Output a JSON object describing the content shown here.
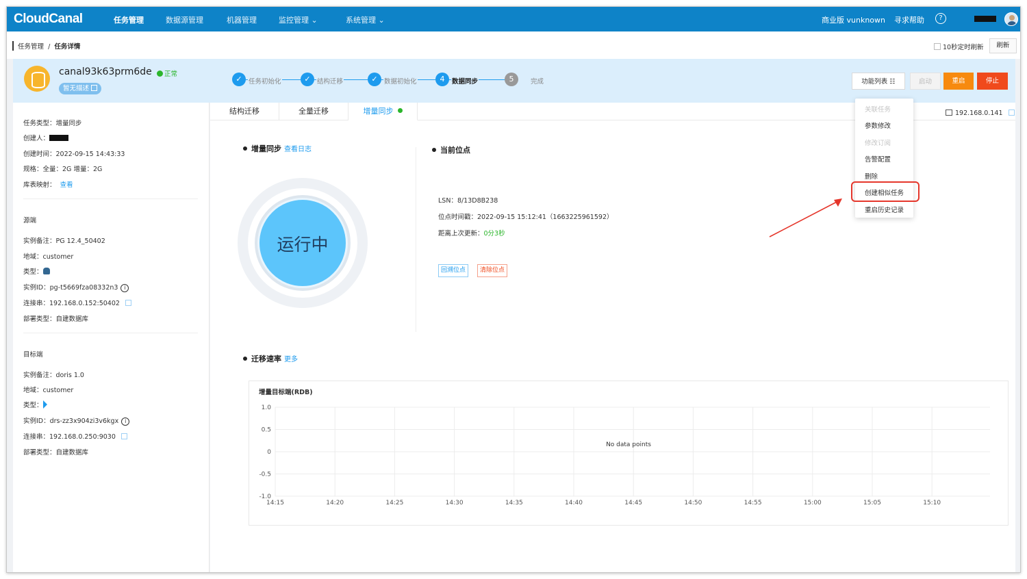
{
  "topnav": {
    "logo": "CloudCanal",
    "items": [
      "任务管理",
      "数据源管理",
      "机器管理",
      "监控管理 ⌄",
      "系统管理 ⌄"
    ],
    "edition": "商业版 vunknown",
    "help": "寻求帮助",
    "help_icon": "?"
  },
  "breadcrumb": {
    "root": "任务管理",
    "sep": "/",
    "current": "任务详情"
  },
  "toolbar": {
    "auto_refresh": "10秒定时刷新",
    "refresh": "刷新"
  },
  "task": {
    "name": "canal93k63prm6de",
    "status": "正常",
    "desc": "暂无描述",
    "steps": [
      {
        "label": "任务初始化",
        "state": "done",
        "num": "✓"
      },
      {
        "label": "结构迁移",
        "state": "done",
        "num": "✓"
      },
      {
        "label": "数据初始化",
        "state": "done",
        "num": "✓"
      },
      {
        "label": "数据同步",
        "state": "current",
        "num": "4"
      },
      {
        "label": "完成",
        "state": "todo",
        "num": "5"
      }
    ],
    "buttons": {
      "func_list": "功能列表 ☷",
      "start": "启动",
      "restart": "重启",
      "stop": "停止"
    }
  },
  "left": {
    "task_type": {
      "label": "任务类型：",
      "value": "增量同步"
    },
    "creator": {
      "label": "创建人："
    },
    "created": {
      "label": "创建时间：",
      "value": "2022-09-15 14:43:33"
    },
    "spec": {
      "label": "规格：",
      "value": "全量：2G 增量：2G"
    },
    "mapping": {
      "label": "库表映射：",
      "value": "查看"
    },
    "source": {
      "title": "源端",
      "remark": {
        "label": "实例备注：",
        "value": "PG 12.4_50402"
      },
      "region": {
        "label": "地域：",
        "value": "customer"
      },
      "type": {
        "label": "类型："
      },
      "id": {
        "label": "实例ID：",
        "value": "pg-t5669fza08332n3"
      },
      "conn": {
        "label": "连接串：",
        "value": "192.168.0.152:50402"
      },
      "deploy": {
        "label": "部署类型：",
        "value": "自建数据库"
      }
    },
    "target": {
      "title": "目标端",
      "remark": {
        "label": "实例备注：",
        "value": "doris 1.0"
      },
      "region": {
        "label": "地域：",
        "value": "customer"
      },
      "type": {
        "label": "类型："
      },
      "id": {
        "label": "实例ID：",
        "value": "drs-zz3x904zi3v6kgx"
      },
      "conn": {
        "label": "连接串：",
        "value": "192.168.0.250:9030"
      },
      "deploy": {
        "label": "部署类型：",
        "value": "自建数据库"
      }
    }
  },
  "tabs": [
    "结构迁移",
    "全量迁移",
    "增量同步"
  ],
  "host": "192.168.0.141",
  "sync": {
    "title": "增量同步",
    "log_link": "查看日志",
    "running": "运行中",
    "pos_title": "当前位点",
    "lsn": {
      "label": "LSN：",
      "value": "8/13D8B238"
    },
    "pos_time": {
      "label": "位点时间戳：",
      "value": "2022-09-15 15:12:41（1663225961592）"
    },
    "last_update": {
      "label": "距离上次更新：",
      "value": "0分3秒"
    },
    "btn_rewind": "回溯位点",
    "btn_clear": "清除位点"
  },
  "rate": {
    "title": "迁移速率",
    "more": "更多"
  },
  "chart_data": {
    "type": "line",
    "title": "增量目标端(RDB)",
    "x": [
      "14:15",
      "14:20",
      "14:25",
      "14:30",
      "14:35",
      "14:40",
      "14:45",
      "14:50",
      "14:55",
      "15:00",
      "15:05",
      "15:10"
    ],
    "y_ticks": [
      "1.0",
      "0.5",
      "0",
      "-0.5",
      "-1.0"
    ],
    "ylim": [
      -1.0,
      1.0
    ],
    "series": [],
    "empty_text": "No data points",
    "grid": true
  },
  "menu": {
    "items": [
      {
        "label": "关联任务",
        "disabled": true
      },
      {
        "label": "参数修改",
        "disabled": false
      },
      {
        "label": "修改订阅",
        "disabled": true
      },
      {
        "label": "告警配置",
        "disabled": false
      },
      {
        "label": "删除",
        "disabled": false
      },
      {
        "label": "创建相似任务",
        "disabled": false
      },
      {
        "label": "重启历史记录",
        "disabled": false
      }
    ]
  },
  "colors": {
    "primary": "#1e9bee",
    "nav": "#0e83c8",
    "restart": "#f78a0f",
    "stop": "#f04a1c",
    "annotation": "#e5362b"
  }
}
